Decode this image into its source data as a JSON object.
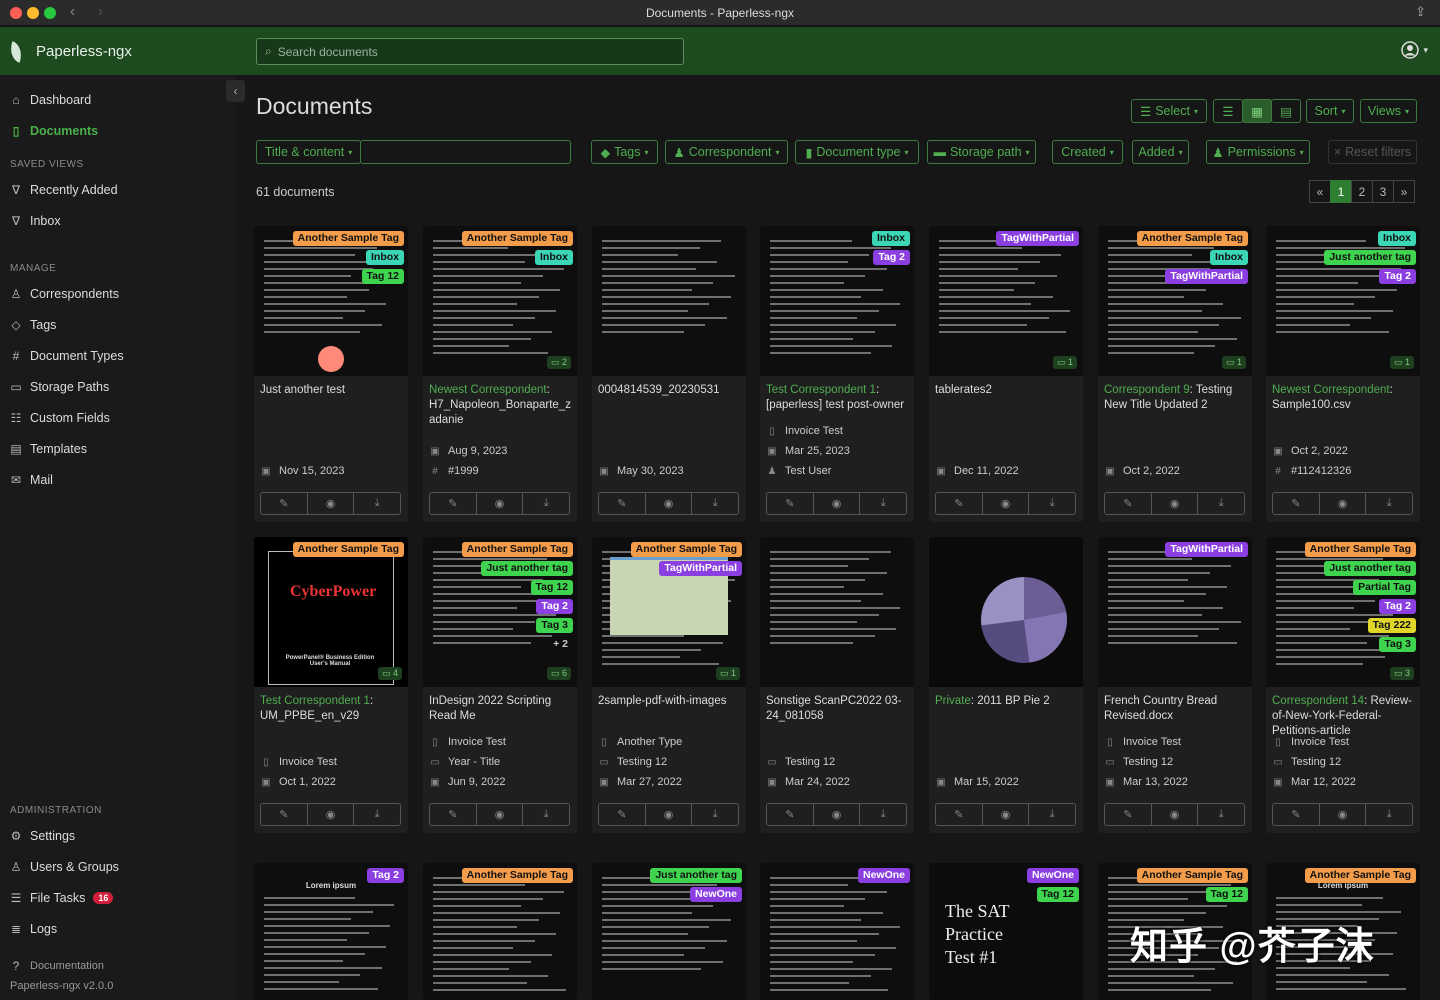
{
  "window": {
    "title": "Documents - Paperless-ngx"
  },
  "app": {
    "brand": "Paperless-ngx",
    "search_placeholder": "Search documents"
  },
  "sidebar": {
    "items": [
      {
        "label": "Dashboard"
      },
      {
        "label": "Documents"
      }
    ],
    "saved_views_heading": "SAVED VIEWS",
    "saved_views": [
      {
        "label": "Recently Added"
      },
      {
        "label": "Inbox"
      }
    ],
    "manage_heading": "MANAGE",
    "manage": [
      {
        "label": "Correspondents"
      },
      {
        "label": "Tags"
      },
      {
        "label": "Document Types"
      },
      {
        "label": "Storage Paths"
      },
      {
        "label": "Custom Fields"
      },
      {
        "label": "Templates"
      },
      {
        "label": "Mail"
      }
    ],
    "admin_heading": "ADMINISTRATION",
    "admin": [
      {
        "label": "Settings"
      },
      {
        "label": "Users & Groups"
      },
      {
        "label": "File Tasks",
        "badge": "16"
      },
      {
        "label": "Logs"
      }
    ],
    "documentation": "Documentation",
    "version": "Paperless-ngx v2.0.0"
  },
  "header": {
    "title": "Documents",
    "select": "Select",
    "sort": "Sort",
    "views": "Views"
  },
  "filters": {
    "title_content": "Title & content",
    "tags": "Tags",
    "correspondent": "Correspondent",
    "document_type": "Document type",
    "storage_path": "Storage path",
    "created": "Created",
    "added": "Added",
    "permissions": "Permissions",
    "reset": "Reset filters"
  },
  "count": "61 documents",
  "pager": [
    "«",
    "1",
    "2",
    "3",
    "»"
  ],
  "colors": {
    "accent": "#4fae50",
    "appbar": "#1d4a1f",
    "tag_orange": "#f39c4a",
    "tag_teal": "#3ad6b6",
    "tag_green": "#3fd44e",
    "tag_purple": "#8b3fe0",
    "tag_yellow": "#e0d62a",
    "tag_cyan": "#2fdcc4"
  },
  "cards": [
    {
      "tags": [
        {
          "t": "Another Sample Tag",
          "c": "#f39c4a"
        },
        {
          "t": "Inbox",
          "c": "#3ad6b6"
        },
        {
          "t": "Tag 12",
          "c": "#3fd44e"
        }
      ],
      "corr": "",
      "title": "Just another test",
      "meta": [
        {
          "t": "Nov 15, 2023",
          "i": "calendar-icon"
        }
      ],
      "note": ""
    },
    {
      "tags": [
        {
          "t": "Another Sample Tag",
          "c": "#f39c4a"
        },
        {
          "t": "Inbox",
          "c": "#3ad6b6"
        }
      ],
      "corr": "Newest Correspondent",
      "title": "H7_Napoleon_Bonaparte_zadanie",
      "meta": [
        {
          "t": "Aug 9, 2023",
          "i": "calendar-icon"
        },
        {
          "t": "#1999",
          "i": "hash-icon"
        }
      ],
      "note": "2"
    },
    {
      "tags": [],
      "corr": "",
      "title": "0004814539_20230531",
      "meta": [
        {
          "t": "May 30, 2023",
          "i": "calendar-icon"
        }
      ],
      "note": ""
    },
    {
      "tags": [
        {
          "t": "Inbox",
          "c": "#3ad6b6"
        },
        {
          "t": "Tag 2",
          "c": "#8b3fe0"
        }
      ],
      "corr": "Test Correspondent 1",
      "title": "[paperless] test post-owner",
      "meta": [
        {
          "t": "Invoice Test",
          "i": "doctype-icon"
        },
        {
          "t": "Mar 25, 2023",
          "i": "calendar-icon"
        },
        {
          "t": "Test User",
          "i": "owner-icon"
        }
      ],
      "note": ""
    },
    {
      "tags": [
        {
          "t": "TagWithPartial",
          "c": "#8b3fe0"
        }
      ],
      "corr": "",
      "title": "tablerates2",
      "meta": [
        {
          "t": "Dec 11, 2022",
          "i": "calendar-icon"
        }
      ],
      "note": "1"
    },
    {
      "tags": [
        {
          "t": "Another Sample Tag",
          "c": "#f39c4a"
        },
        {
          "t": "Inbox",
          "c": "#3ad6b6"
        },
        {
          "t": "TagWithPartial",
          "c": "#8b3fe0"
        }
      ],
      "corr": "Correspondent 9",
      "title": "Testing New Title Updated 2",
      "meta": [
        {
          "t": "Oct 2, 2022",
          "i": "calendar-icon"
        }
      ],
      "note": "1"
    },
    {
      "tags": [
        {
          "t": "Inbox",
          "c": "#3ad6b6"
        },
        {
          "t": "Just another tag",
          "c": "#3fd44e"
        },
        {
          "t": "Tag 2",
          "c": "#8b3fe0"
        }
      ],
      "corr": "Newest Correspondent",
      "title": "Sample100.csv",
      "meta": [
        {
          "t": "Oct 2, 2022",
          "i": "calendar-icon"
        },
        {
          "t": "#112412326",
          "i": "hash-icon"
        }
      ],
      "note": "1"
    },
    {
      "tags": [
        {
          "t": "Another Sample Tag",
          "c": "#f39c4a"
        }
      ],
      "corr": "Test Correspondent 1",
      "title": "UM_PPBE_en_v29",
      "meta": [
        {
          "t": "Invoice Test",
          "i": "doctype-icon"
        },
        {
          "t": "Oct 1, 2022",
          "i": "calendar-icon"
        }
      ],
      "note": "4"
    },
    {
      "tags": [
        {
          "t": "Another Sample Tag",
          "c": "#f39c4a"
        },
        {
          "t": "Just another tag",
          "c": "#3fd44e"
        },
        {
          "t": "Tag 12",
          "c": "#3fd44e"
        },
        {
          "t": "Tag 2",
          "c": "#8b3fe0"
        },
        {
          "t": "Tag 3",
          "c": "#3fd44e"
        },
        {
          "t": "+ 2",
          "c": "#1f1f1f"
        }
      ],
      "corr": "",
      "title": "InDesign 2022 Scripting Read Me",
      "meta": [
        {
          "t": "Invoice Test",
          "i": "doctype-icon"
        },
        {
          "t": "Year - Title",
          "i": "folder-icon"
        },
        {
          "t": "Jun 9, 2022",
          "i": "calendar-icon"
        }
      ],
      "note": "6"
    },
    {
      "tags": [
        {
          "t": "Another Sample Tag",
          "c": "#f39c4a"
        },
        {
          "t": "TagWithPartial",
          "c": "#8b3fe0"
        }
      ],
      "corr": "",
      "title": "2sample-pdf-with-images",
      "meta": [
        {
          "t": "Another Type",
          "i": "doctype-icon"
        },
        {
          "t": "Testing 12",
          "i": "folder-icon"
        },
        {
          "t": "Mar 27, 2022",
          "i": "calendar-icon"
        }
      ],
      "note": "1"
    },
    {
      "tags": [],
      "corr": "",
      "title": "Sonstige ScanPC2022 03-24_081058",
      "meta": [
        {
          "t": "Testing 12",
          "i": "folder-icon"
        },
        {
          "t": "Mar 24, 2022",
          "i": "calendar-icon"
        }
      ],
      "note": ""
    },
    {
      "tags": [],
      "corr": "Private",
      "title": "2011 BP Pie 2",
      "meta": [
        {
          "t": "Mar 15, 2022",
          "i": "calendar-icon"
        }
      ],
      "note": ""
    },
    {
      "tags": [
        {
          "t": "TagWithPartial",
          "c": "#8b3fe0"
        }
      ],
      "corr": "",
      "title": "French Country Bread Revised.docx",
      "meta": [
        {
          "t": "Invoice Test",
          "i": "doctype-icon"
        },
        {
          "t": "Testing 12",
          "i": "folder-icon"
        },
        {
          "t": "Mar 13, 2022",
          "i": "calendar-icon"
        }
      ],
      "note": ""
    },
    {
      "tags": [
        {
          "t": "Another Sample Tag",
          "c": "#f39c4a"
        },
        {
          "t": "Just another tag",
          "c": "#3fd44e"
        },
        {
          "t": "Partial Tag",
          "c": "#3fd44e"
        },
        {
          "t": "Tag 2",
          "c": "#8b3fe0"
        },
        {
          "t": "Tag 222",
          "c": "#e0d62a"
        },
        {
          "t": "Tag 3",
          "c": "#3fd44e"
        }
      ],
      "corr": "Correspondent 14",
      "title": "Review-of-New-York-Federal-Petitions-article",
      "meta": [
        {
          "t": "Invoice Test",
          "i": "doctype-icon"
        },
        {
          "t": "Testing 12",
          "i": "folder-icon"
        },
        {
          "t": "Mar 12, 2022",
          "i": "calendar-icon"
        }
      ],
      "note": "3"
    },
    {
      "tags": [
        {
          "t": "Tag 2",
          "c": "#8b3fe0"
        }
      ],
      "corr": "",
      "title": "",
      "meta": [],
      "note": ""
    },
    {
      "tags": [
        {
          "t": "Another Sample Tag",
          "c": "#f39c4a"
        }
      ],
      "corr": "",
      "title": "",
      "meta": [],
      "note": ""
    },
    {
      "tags": [
        {
          "t": "Just another tag",
          "c": "#3fd44e"
        },
        {
          "t": "NewOne",
          "c": "#8b3fe0"
        }
      ],
      "corr": "",
      "title": "",
      "meta": [],
      "note": ""
    },
    {
      "tags": [
        {
          "t": "NewOne",
          "c": "#8b3fe0"
        }
      ],
      "corr": "",
      "title": "",
      "meta": [],
      "note": ""
    },
    {
      "tags": [
        {
          "t": "NewOne",
          "c": "#8b3fe0"
        },
        {
          "t": "Tag 12",
          "c": "#3fd44e"
        }
      ],
      "corr": "",
      "title": "",
      "meta": [],
      "note": ""
    },
    {
      "tags": [
        {
          "t": "Another Sample Tag",
          "c": "#f39c4a"
        },
        {
          "t": "Tag 12",
          "c": "#3fd44e"
        }
      ],
      "corr": "",
      "title": "",
      "meta": [],
      "note": ""
    },
    {
      "tags": [
        {
          "t": "Another Sample Tag",
          "c": "#f39c4a"
        }
      ],
      "corr": "",
      "title": "",
      "meta": [],
      "note": ""
    }
  ],
  "thumb_text": {
    "cyberpower": "CyberPower",
    "cyberpower_sub": "PowerPanel® Business Edition User's Manual",
    "sat1": "The SAT",
    "sat2": "Practice",
    "sat3": "Test #1",
    "lorem": "Lorem ipsum"
  },
  "watermark": "知乎 @芥子沫"
}
